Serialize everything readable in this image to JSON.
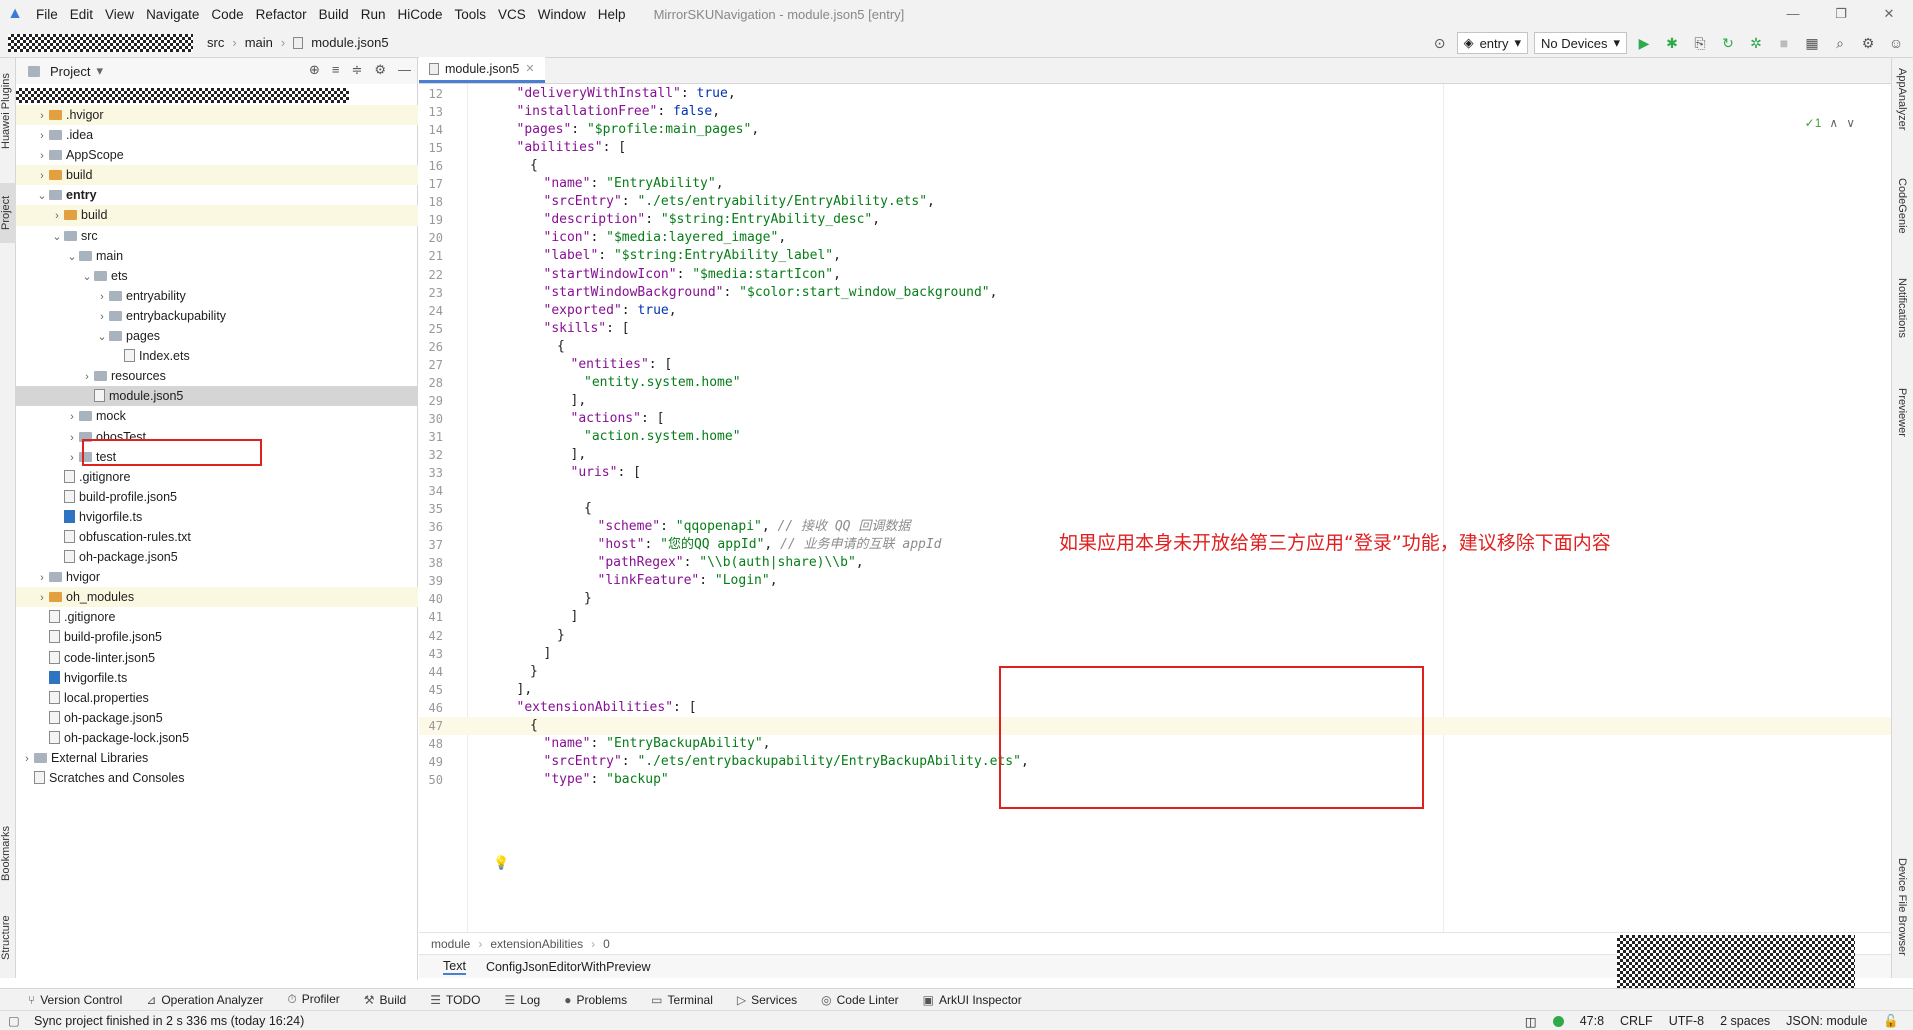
{
  "menubar": {
    "items": [
      "File",
      "Edit",
      "View",
      "Navigate",
      "Code",
      "Refactor",
      "Build",
      "Run",
      "HiCode",
      "Tools",
      "VCS",
      "Window",
      "Help"
    ],
    "window_title": "MirrorSKUNavigation - module.json5 [entry]"
  },
  "navbar": {
    "breadcrumb": [
      "src",
      "main",
      "module.json5"
    ],
    "run_config": "entry",
    "device": "No Devices"
  },
  "left_strip": {
    "huawei_plugins": "Huawei Plugins",
    "project": "Project",
    "bookmarks": "Bookmarks",
    "structure": "Structure"
  },
  "right_strip": {
    "appanalyzer": "AppAnalyzer",
    "codegenie": "CodeGenie",
    "notifications": "Notifications",
    "previewer": "Previewer",
    "device_file_browser": "Device File Browser"
  },
  "project_panel": {
    "title": "Project",
    "tree": [
      {
        "label": ".hvigor",
        "indent": 1,
        "chev": ">",
        "kind": "folder-orange",
        "hl": true
      },
      {
        "label": ".idea",
        "indent": 1,
        "chev": ">",
        "kind": "folder"
      },
      {
        "label": "AppScope",
        "indent": 1,
        "chev": ">",
        "kind": "folder"
      },
      {
        "label": "build",
        "indent": 1,
        "chev": ">",
        "kind": "folder-orange",
        "hl": true
      },
      {
        "label": "entry",
        "indent": 1,
        "chev": "v",
        "kind": "folder",
        "bold": true
      },
      {
        "label": "build",
        "indent": 2,
        "chev": ">",
        "kind": "folder-orange",
        "hl": true
      },
      {
        "label": "src",
        "indent": 2,
        "chev": "v",
        "kind": "folder"
      },
      {
        "label": "main",
        "indent": 3,
        "chev": "v",
        "kind": "folder"
      },
      {
        "label": "ets",
        "indent": 4,
        "chev": "v",
        "kind": "folder"
      },
      {
        "label": "entryability",
        "indent": 5,
        "chev": ">",
        "kind": "folder"
      },
      {
        "label": "entrybackupability",
        "indent": 5,
        "chev": ">",
        "kind": "folder"
      },
      {
        "label": "pages",
        "indent": 5,
        "chev": "v",
        "kind": "folder"
      },
      {
        "label": "Index.ets",
        "indent": 6,
        "chev": "",
        "kind": "file"
      },
      {
        "label": "resources",
        "indent": 4,
        "chev": ">",
        "kind": "folder"
      },
      {
        "label": "module.json5",
        "indent": 4,
        "chev": "",
        "kind": "file",
        "sel": true
      },
      {
        "label": "mock",
        "indent": 3,
        "chev": ">",
        "kind": "folder"
      },
      {
        "label": "ohosTest",
        "indent": 3,
        "chev": ">",
        "kind": "folder"
      },
      {
        "label": "test",
        "indent": 3,
        "chev": ">",
        "kind": "folder"
      },
      {
        "label": ".gitignore",
        "indent": 2,
        "chev": "",
        "kind": "file"
      },
      {
        "label": "build-profile.json5",
        "indent": 2,
        "chev": "",
        "kind": "file"
      },
      {
        "label": "hvigorfile.ts",
        "indent": 2,
        "chev": "",
        "kind": "file-ts"
      },
      {
        "label": "obfuscation-rules.txt",
        "indent": 2,
        "chev": "",
        "kind": "file"
      },
      {
        "label": "oh-package.json5",
        "indent": 2,
        "chev": "",
        "kind": "file"
      },
      {
        "label": "hvigor",
        "indent": 1,
        "chev": ">",
        "kind": "folder"
      },
      {
        "label": "oh_modules",
        "indent": 1,
        "chev": ">",
        "kind": "folder-orange",
        "hl": true
      },
      {
        "label": ".gitignore",
        "indent": 1,
        "chev": "",
        "kind": "file"
      },
      {
        "label": "build-profile.json5",
        "indent": 1,
        "chev": "",
        "kind": "file"
      },
      {
        "label": "code-linter.json5",
        "indent": 1,
        "chev": "",
        "kind": "file"
      },
      {
        "label": "hvigorfile.ts",
        "indent": 1,
        "chev": "",
        "kind": "file-ts"
      },
      {
        "label": "local.properties",
        "indent": 1,
        "chev": "",
        "kind": "file"
      },
      {
        "label": "oh-package.json5",
        "indent": 1,
        "chev": "",
        "kind": "file"
      },
      {
        "label": "oh-package-lock.json5",
        "indent": 1,
        "chev": "",
        "kind": "file"
      },
      {
        "label": "External Libraries",
        "indent": 0,
        "chev": ">",
        "kind": "lib"
      },
      {
        "label": "Scratches and Consoles",
        "indent": 0,
        "chev": "",
        "kind": "scratch"
      }
    ]
  },
  "editor": {
    "tab": "module.json5",
    "inspection_count": "1",
    "annotation": "如果应用本身未开放给第三方应用“登录”功能，建议移除下面内容",
    "lines": [
      {
        "n": "12",
        "indent": 1,
        "t": [
          [
            "k",
            "\"deliveryWithInstall\""
          ],
          [
            "p",
            ": "
          ],
          [
            "b",
            "true"
          ],
          [
            "p",
            ","
          ]
        ]
      },
      {
        "n": "13",
        "indent": 1,
        "t": [
          [
            "k",
            "\"installationFree\""
          ],
          [
            "p",
            ": "
          ],
          [
            "b",
            "false"
          ],
          [
            "p",
            ","
          ]
        ]
      },
      {
        "n": "14",
        "indent": 1,
        "t": [
          [
            "k",
            "\"pages\""
          ],
          [
            "p",
            ": "
          ],
          [
            "s",
            "\"$profile:main_pages\""
          ],
          [
            "p",
            ","
          ]
        ]
      },
      {
        "n": "15",
        "indent": 1,
        "t": [
          [
            "k",
            "\"abilities\""
          ],
          [
            "p",
            ": ["
          ]
        ]
      },
      {
        "n": "16",
        "indent": 2,
        "t": [
          [
            "p",
            "{"
          ]
        ]
      },
      {
        "n": "17",
        "indent": 3,
        "t": [
          [
            "k",
            "\"name\""
          ],
          [
            "p",
            ": "
          ],
          [
            "s",
            "\"EntryAbility\""
          ],
          [
            "p",
            ","
          ]
        ]
      },
      {
        "n": "18",
        "indent": 3,
        "t": [
          [
            "k",
            "\"srcEntry\""
          ],
          [
            "p",
            ": "
          ],
          [
            "s",
            "\"./ets/entryability/EntryAbility.ets\""
          ],
          [
            "p",
            ","
          ]
        ]
      },
      {
        "n": "19",
        "indent": 3,
        "t": [
          [
            "k",
            "\"description\""
          ],
          [
            "p",
            ": "
          ],
          [
            "s",
            "\"$string:EntryAbility_desc\""
          ],
          [
            "p",
            ","
          ]
        ]
      },
      {
        "n": "20",
        "indent": 3,
        "t": [
          [
            "k",
            "\"icon\""
          ],
          [
            "p",
            ": "
          ],
          [
            "s",
            "\"$media:layered_image\""
          ],
          [
            "p",
            ","
          ]
        ]
      },
      {
        "n": "21",
        "indent": 3,
        "t": [
          [
            "k",
            "\"label\""
          ],
          [
            "p",
            ": "
          ],
          [
            "s",
            "\"$string:EntryAbility_label\""
          ],
          [
            "p",
            ","
          ]
        ]
      },
      {
        "n": "22",
        "indent": 3,
        "t": [
          [
            "k",
            "\"startWindowIcon\""
          ],
          [
            "p",
            ": "
          ],
          [
            "s",
            "\"$media:startIcon\""
          ],
          [
            "p",
            ","
          ]
        ]
      },
      {
        "n": "23",
        "indent": 3,
        "t": [
          [
            "k",
            "\"startWindowBackground\""
          ],
          [
            "p",
            ": "
          ],
          [
            "s",
            "\"$color:start_window_background\""
          ],
          [
            "p",
            ","
          ]
        ]
      },
      {
        "n": "24",
        "indent": 3,
        "t": [
          [
            "k",
            "\"exported\""
          ],
          [
            "p",
            ": "
          ],
          [
            "b",
            "true"
          ],
          [
            "p",
            ","
          ]
        ]
      },
      {
        "n": "25",
        "indent": 3,
        "t": [
          [
            "k",
            "\"skills\""
          ],
          [
            "p",
            ": ["
          ]
        ]
      },
      {
        "n": "26",
        "indent": 4,
        "t": [
          [
            "p",
            "{"
          ]
        ]
      },
      {
        "n": "27",
        "indent": 5,
        "t": [
          [
            "k",
            "\"entities\""
          ],
          [
            "p",
            ": ["
          ]
        ]
      },
      {
        "n": "28",
        "indent": 6,
        "t": [
          [
            "s",
            "\"entity.system.home\""
          ]
        ]
      },
      {
        "n": "29",
        "indent": 5,
        "t": [
          [
            "p",
            "],"
          ]
        ]
      },
      {
        "n": "30",
        "indent": 5,
        "t": [
          [
            "k",
            "\"actions\""
          ],
          [
            "p",
            ": ["
          ]
        ]
      },
      {
        "n": "31",
        "indent": 6,
        "t": [
          [
            "s",
            "\"action.system.home\""
          ]
        ]
      },
      {
        "n": "32",
        "indent": 5,
        "t": [
          [
            "p",
            "],"
          ]
        ]
      },
      {
        "n": "33",
        "indent": 5,
        "t": [
          [
            "k",
            "\"uris\""
          ],
          [
            "p",
            ": ["
          ]
        ]
      },
      {
        "n": "34",
        "indent": 0,
        "t": []
      },
      {
        "n": "35",
        "indent": 6,
        "t": [
          [
            "p",
            "{"
          ]
        ]
      },
      {
        "n": "36",
        "indent": 7,
        "t": [
          [
            "k",
            "\"scheme\""
          ],
          [
            "p",
            ": "
          ],
          [
            "s",
            "\"qqopenapi\""
          ],
          [
            "p",
            ", "
          ],
          [
            "cm",
            "// 接收 QQ 回调数据"
          ]
        ]
      },
      {
        "n": "37",
        "indent": 7,
        "t": [
          [
            "k",
            "\"host\""
          ],
          [
            "p",
            ": "
          ],
          [
            "s",
            "\"您的QQ appId\""
          ],
          [
            "p",
            ", "
          ],
          [
            "cm",
            "// 业务申请的互联 appId"
          ]
        ]
      },
      {
        "n": "38",
        "indent": 7,
        "t": [
          [
            "k",
            "\"pathRegex\""
          ],
          [
            "p",
            ": "
          ],
          [
            "s",
            "\"\\\\b(auth|share)\\\\b\""
          ],
          [
            "p",
            ","
          ]
        ]
      },
      {
        "n": "39",
        "indent": 7,
        "t": [
          [
            "k",
            "\"linkFeature\""
          ],
          [
            "p",
            ": "
          ],
          [
            "s",
            "\"Login\""
          ],
          [
            "p",
            ","
          ]
        ]
      },
      {
        "n": "40",
        "indent": 6,
        "t": [
          [
            "p",
            "}"
          ]
        ]
      },
      {
        "n": "41",
        "indent": 5,
        "t": [
          [
            "p",
            "]"
          ]
        ]
      },
      {
        "n": "42",
        "indent": 4,
        "t": [
          [
            "p",
            "}"
          ]
        ]
      },
      {
        "n": "43",
        "indent": 3,
        "t": [
          [
            "p",
            "]"
          ]
        ]
      },
      {
        "n": "44",
        "indent": 2,
        "t": [
          [
            "p",
            "}"
          ]
        ]
      },
      {
        "n": "45",
        "indent": 1,
        "t": [
          [
            "p",
            "],"
          ]
        ]
      },
      {
        "n": "46",
        "indent": 1,
        "t": [
          [
            "k",
            "\"extensionAbilities\""
          ],
          [
            "p",
            ": ["
          ]
        ]
      },
      {
        "n": "47",
        "indent": 2,
        "t": [
          [
            "p",
            "{"
          ]
        ],
        "cur": true
      },
      {
        "n": "48",
        "indent": 3,
        "t": [
          [
            "k",
            "\"name\""
          ],
          [
            "p",
            ": "
          ],
          [
            "s",
            "\"EntryBackupAbility\""
          ],
          [
            "p",
            ","
          ]
        ]
      },
      {
        "n": "49",
        "indent": 3,
        "t": [
          [
            "k",
            "\"srcEntry\""
          ],
          [
            "p",
            ": "
          ],
          [
            "s",
            "\"./ets/entrybackupability/EntryBackupAbility.ets\""
          ],
          [
            "p",
            ","
          ]
        ]
      },
      {
        "n": "50",
        "indent": 3,
        "t": [
          [
            "k",
            "\"type\""
          ],
          [
            "p",
            ": "
          ],
          [
            "s",
            "\"backup\""
          ]
        ]
      }
    ],
    "breadcrumb": [
      "module",
      "extensionAbilities",
      "0"
    ],
    "bottom_tabs": [
      "Text",
      "ConfigJsonEditorWithPreview"
    ]
  },
  "tool_windows": [
    "Version Control",
    "Operation Analyzer",
    "Profiler",
    "Build",
    "TODO",
    "Log",
    "Problems",
    "Terminal",
    "Services",
    "Code Linter",
    "ArkUI Inspector"
  ],
  "status": {
    "message": "Sync project finished in 2 s 336 ms (today 16:24)",
    "position": "47:8",
    "line_sep": "CRLF",
    "encoding": "UTF-8",
    "indent": "2 spaces",
    "file_type": "JSON: module"
  },
  "colors": {
    "keyword": "#871094",
    "string": "#067d17",
    "boolean": "#0033b3",
    "comment": "#8c8c8c",
    "annotation": "#e02020",
    "accent": "#4a7fd4"
  }
}
